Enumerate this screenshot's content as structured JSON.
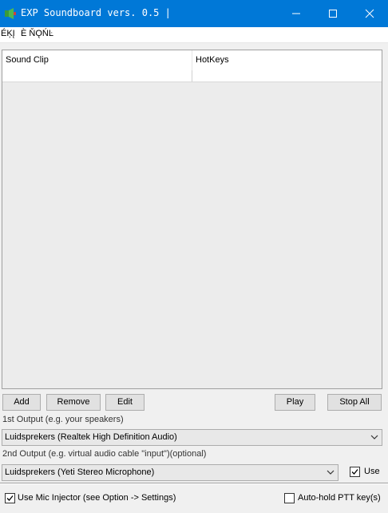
{
  "window": {
    "title": "EXP Soundboard vers. 0.5 |",
    "icon": "app-icon",
    "controls": [
      "minimize-icon",
      "maximize-icon",
      "close-icon"
    ]
  },
  "menu": [
    "ÉĶĮ",
    "È ŇǪŃĿ"
  ],
  "table": {
    "columns": [
      "Sound Clip",
      "HotKeys"
    ],
    "rows": [
      [
        "",
        ""
      ]
    ]
  },
  "buttons": {
    "add": "Add",
    "remove": "Remove",
    "edit": "Edit",
    "play": "Play",
    "stop_all": "Stop All"
  },
  "output1": {
    "label": "1st Output (e.g. your speakers)",
    "selected": "Luidsprekers (Realtek High Definition Audio)"
  },
  "output2": {
    "label": "2nd Output (e.g. virtual audio cable \"input\")(optional)",
    "selected": "Luidsprekers (Yeti Stereo Microphone)",
    "use_label": "Use",
    "use_checked": true
  },
  "footer": {
    "mic_injector_label": "Use Mic Injector (see Option -> Settings)",
    "mic_injector_checked": true,
    "autohold_label": "Auto-hold PTT key(s)",
    "autohold_checked": false
  },
  "colors": {
    "titlebar": "#0078d7",
    "window_bg": "#f0f0f0"
  }
}
